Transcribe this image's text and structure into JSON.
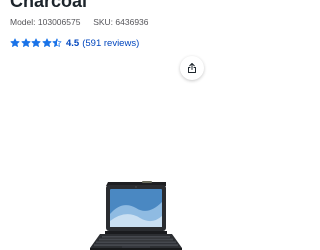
{
  "product": {
    "title_fragment": "Charcoal",
    "model_label": "Model:",
    "model_number": "103006575",
    "sku_label": "SKU:",
    "sku_number": "6436936",
    "rating": {
      "stars": 4.5,
      "value_text": "4.5",
      "reviews_text": "(591 reviews)"
    }
  },
  "icons": {
    "star": "star-icon",
    "share": "share-icon"
  },
  "colors": {
    "star_fill": "#1a73e8",
    "link": "#0046be",
    "text_secondary": "#55555a",
    "device_frame": "#2a2c30",
    "screen_blue": "#4a88c2"
  }
}
